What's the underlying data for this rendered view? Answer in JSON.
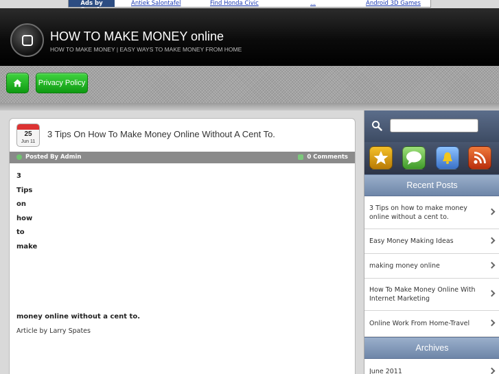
{
  "ads": {
    "label": "Ads by Google",
    "links": [
      "Antiek Salontafel",
      "Find Honda Civic",
      "...",
      "Android 3D Games"
    ]
  },
  "header": {
    "title": "HOW TO MAKE MONEY online",
    "tagline": "HOW TO MAKE MONEY | EASY WAYS TO MAKE MONEY FROM HOME"
  },
  "nav": {
    "home_icon": "home-icon",
    "items": [
      "Privacy Policy"
    ]
  },
  "post": {
    "date_day": "25",
    "date_month": "Jun 11",
    "title": "3 Tips On How To Make Money Online Without A Cent To.",
    "author": "Posted By Admin",
    "comments": "0 Comments",
    "words": [
      "3",
      "Tips",
      "on",
      "how",
      "to",
      "make"
    ],
    "line": "money online without a cent to.",
    "credit": "Article by Larry Spates"
  },
  "sidebar": {
    "search_placeholder": "",
    "icons": [
      "star-icon",
      "chat-icon",
      "bell-icon",
      "rss-icon"
    ],
    "recent_heading": "Recent Posts",
    "recent_posts": [
      "3 Tips on how to make money online without a cent to.",
      "Easy Money Making Ideas",
      "making money online",
      "How To Make Money Online With Internet Marketing",
      "Online Work From Home-Travel"
    ],
    "archives_heading": "Archives",
    "archives": [
      "June 2011"
    ]
  },
  "colors": {
    "nav_button": "#1fb51f",
    "header_bg": "#000000",
    "sidebar_heading": "#7f95b6",
    "meta_bar": "#8a8a8a"
  }
}
